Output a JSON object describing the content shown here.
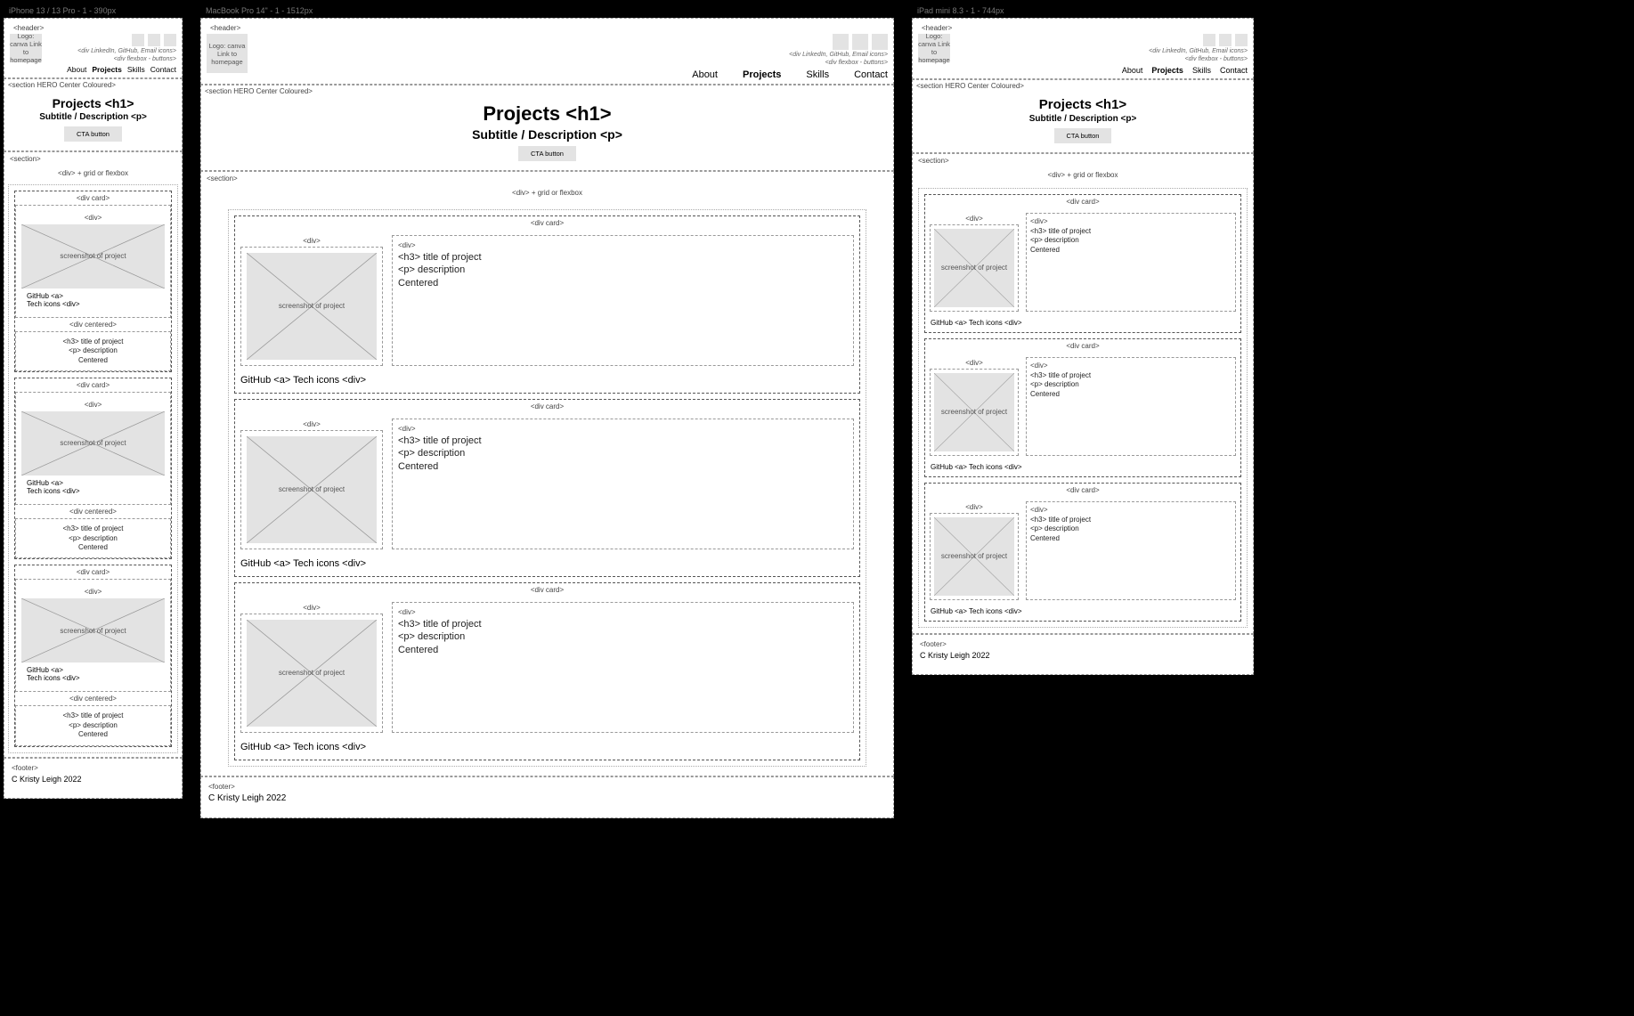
{
  "frames": {
    "phone": "iPhone 13 / 13 Pro - 1 - 390px",
    "mac": "MacBook Pro 14\" - 1 - 1512px",
    "ipad": "iPad mini 8.3 - 1 - 744px"
  },
  "header": {
    "tag": "<header>",
    "logo_text": "Logo: canva Link to homepage",
    "social_hint": "<div LinkedIn, GitHub, Email icons>",
    "nav_hint": "<div flexbox - buttons>",
    "nav": {
      "about": "About",
      "projects": "Projects",
      "skills": "Skills",
      "contact": "Contact"
    }
  },
  "hero": {
    "tag": "<section HERO Center Coloured>",
    "h1": "Projects <h1>",
    "sub": "Subtitle / Description <p>",
    "cta": "CTA button"
  },
  "section_tag": "<section>",
  "grid_label": "<div> + grid or flexbox",
  "card": {
    "tag": "<div card>",
    "col_tag": "<div>",
    "centered_tag": "<div centered>",
    "screenshot": "screenshot of project",
    "github": "GitHub <a>",
    "tech": "Tech icons <div>",
    "title": "<h3> title of project",
    "desc": "<p> description",
    "centered": "Centered",
    "github_tech_line": "GitHub <a>  Tech icons <div>"
  },
  "footer": {
    "tag": "<footer>",
    "copy": "C Kristy Leigh 2022"
  }
}
